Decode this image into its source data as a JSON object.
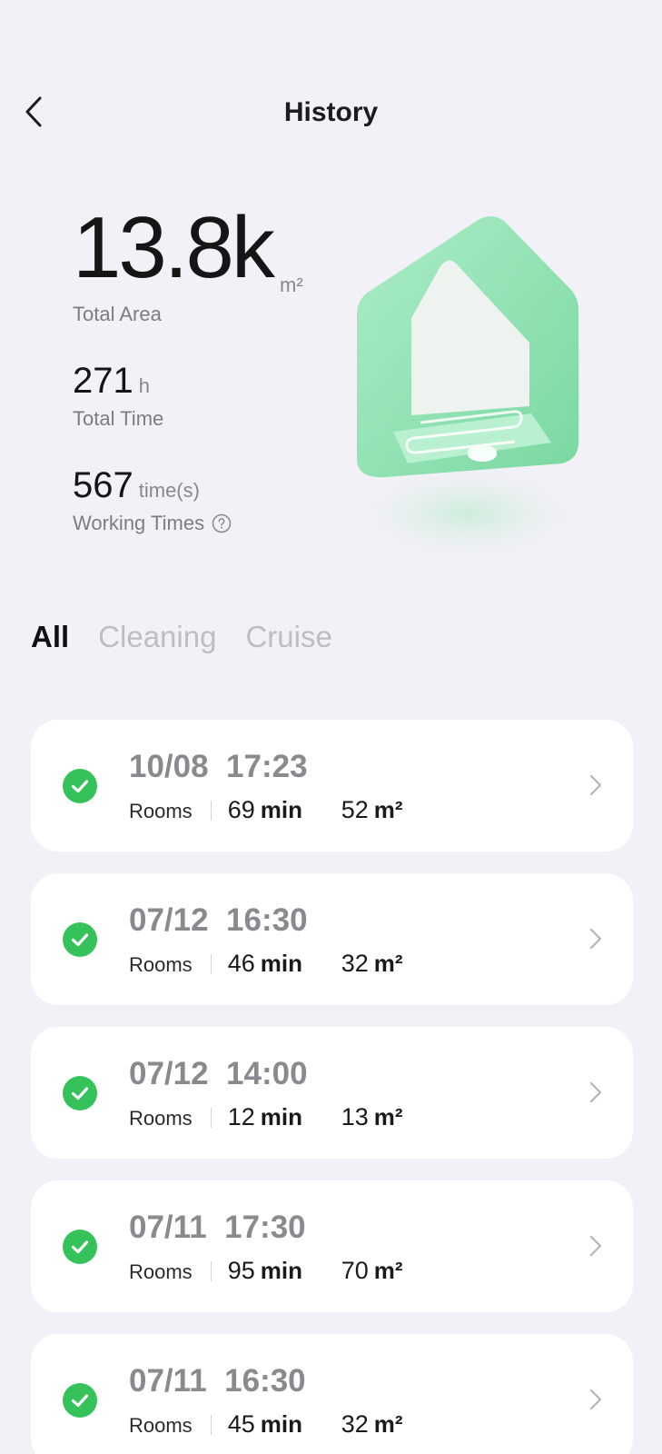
{
  "header": {
    "title": "History"
  },
  "stats": {
    "total_area": {
      "value": "13.8k",
      "unit": "m²",
      "label": "Total Area"
    },
    "total_time": {
      "value": "271",
      "unit": "h",
      "label": "Total Time"
    },
    "working_times": {
      "value": "567",
      "unit": "time(s)",
      "label": "Working Times"
    }
  },
  "tabs": [
    {
      "label": "All",
      "active": true
    },
    {
      "label": "Cleaning",
      "active": false
    },
    {
      "label": "Cruise",
      "active": false
    }
  ],
  "records": [
    {
      "date": "10/08  17:23",
      "mode": "Rooms",
      "duration": "69",
      "duration_unit": "min",
      "area": "52",
      "area_unit": "m²",
      "status": "completed"
    },
    {
      "date": "07/12  16:30",
      "mode": "Rooms",
      "duration": "46",
      "duration_unit": "min",
      "area": "32",
      "area_unit": "m²",
      "status": "completed"
    },
    {
      "date": "07/12  14:00",
      "mode": "Rooms",
      "duration": "12",
      "duration_unit": "min",
      "area": "13",
      "area_unit": "m²",
      "status": "completed"
    },
    {
      "date": "07/11  17:30",
      "mode": "Rooms",
      "duration": "95",
      "duration_unit": "min",
      "area": "70",
      "area_unit": "m²",
      "status": "completed"
    },
    {
      "date": "07/11  16:30",
      "mode": "Rooms",
      "duration": "45",
      "duration_unit": "min",
      "area": "32",
      "area_unit": "m²",
      "status": "completed"
    }
  ],
  "colors": {
    "background": "#f2f1f7",
    "card": "#ffffff",
    "success": "#36c25a",
    "accent_house": "#8fe0b0"
  },
  "icons": {
    "back": "chevron-left-icon",
    "help": "question-circle-icon",
    "status": "check-circle-icon",
    "row_action": "chevron-right-icon"
  }
}
